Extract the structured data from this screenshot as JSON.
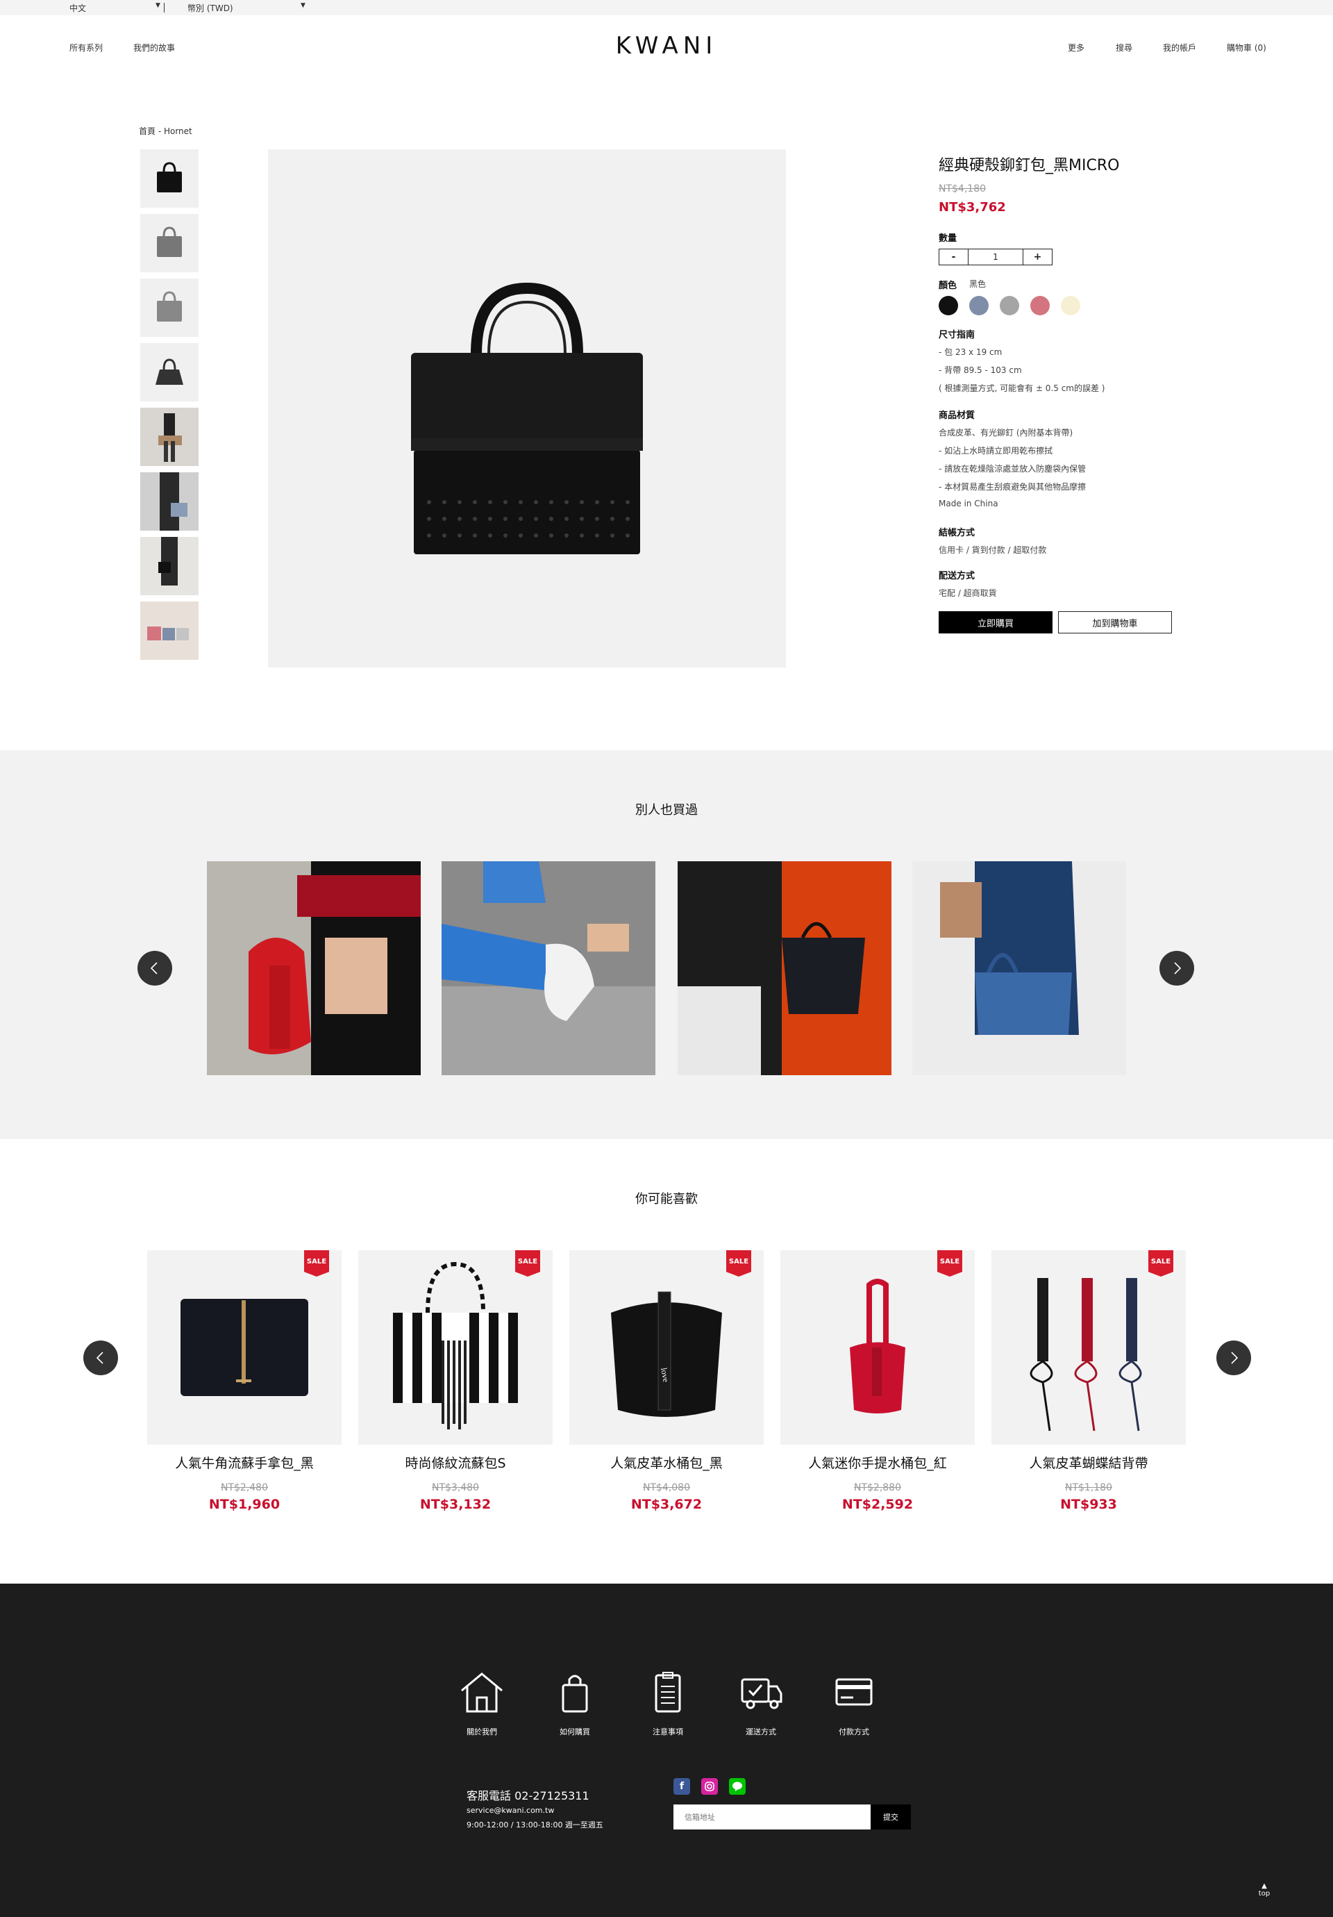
{
  "topbar": {
    "language": "中文",
    "currency": "幣別 (TWD)"
  },
  "header": {
    "left_nav": [
      "所有系列",
      "我們的故事"
    ],
    "logo": "KWANI",
    "right_nav": [
      "更多",
      "搜尋",
      "我的帳戶",
      "購物車 (0)"
    ]
  },
  "breadcrumb": "首頁 - Hornet",
  "product": {
    "title": "經典硬殼鉚釘包_黑MICRO",
    "old_price": "NT$4,180",
    "price": "NT$3,762",
    "quantity_label": "數量",
    "quantity_minus": "-",
    "quantity_value": "1",
    "quantity_plus": "+",
    "color_label": "顏色",
    "color_selected": "黑色",
    "colors": [
      "#111111",
      "#7f8ea8",
      "#a5a5a5",
      "#d4747e",
      "#f7efd3"
    ],
    "size_label": "尺寸指南",
    "size_lines": [
      "- 包 23 x 19 cm",
      "- 背帶 89.5 - 103 cm",
      "( 根據測量方式, 可能會有 ± 0.5 cm的誤差 )"
    ],
    "material_label": "商品材質",
    "material_lines": [
      "合成皮革、有光鉚釘 (內附基本背帶)",
      "- 如沾上水時請立即用乾布擦拭",
      "- 請放在乾燥陰涼處並放入防塵袋內保管",
      "- 本材質易產生刮痕避免與其他物品摩擦",
      "Made in China"
    ],
    "payment_label": "結帳方式",
    "payment_text": "信用卡 / 貨到付款 / 超取付款",
    "shipping_label": "配送方式",
    "shipping_text": "宅配 / 超商取貨",
    "buy_now": "立即購買",
    "add_cart": "加到購物車"
  },
  "also_bought": {
    "title": "別人也買過"
  },
  "recommend": {
    "title": "你可能喜歡",
    "sale_badge": "SALE",
    "items": [
      {
        "name": "人氣牛角流蘇手拿包_黑",
        "old": "NT$2,480",
        "price": "NT$1,960"
      },
      {
        "name": "時尚條紋流蘇包S",
        "old": "NT$3,480",
        "price": "NT$3,132"
      },
      {
        "name": "人氣皮革水桶包_黑",
        "old": "NT$4,080",
        "price": "NT$3,672"
      },
      {
        "name": "人氣迷你手提水桶包_紅",
        "old": "NT$2,880",
        "price": "NT$2,592"
      },
      {
        "name": "人氣皮革蝴蝶結背帶",
        "old": "NT$1,180",
        "price": "NT$933"
      }
    ]
  },
  "footer": {
    "icons": [
      "關於我們",
      "如何購買",
      "注意事項",
      "運送方式",
      "付款方式"
    ],
    "phone": "客服電話 02-27125311",
    "email": "service@kwani.com.tw",
    "hours": "9:00-12:00 / 13:00-18:00 週一至週五",
    "email_placeholder": "信箱地址",
    "submit": "提交",
    "top": "top"
  }
}
